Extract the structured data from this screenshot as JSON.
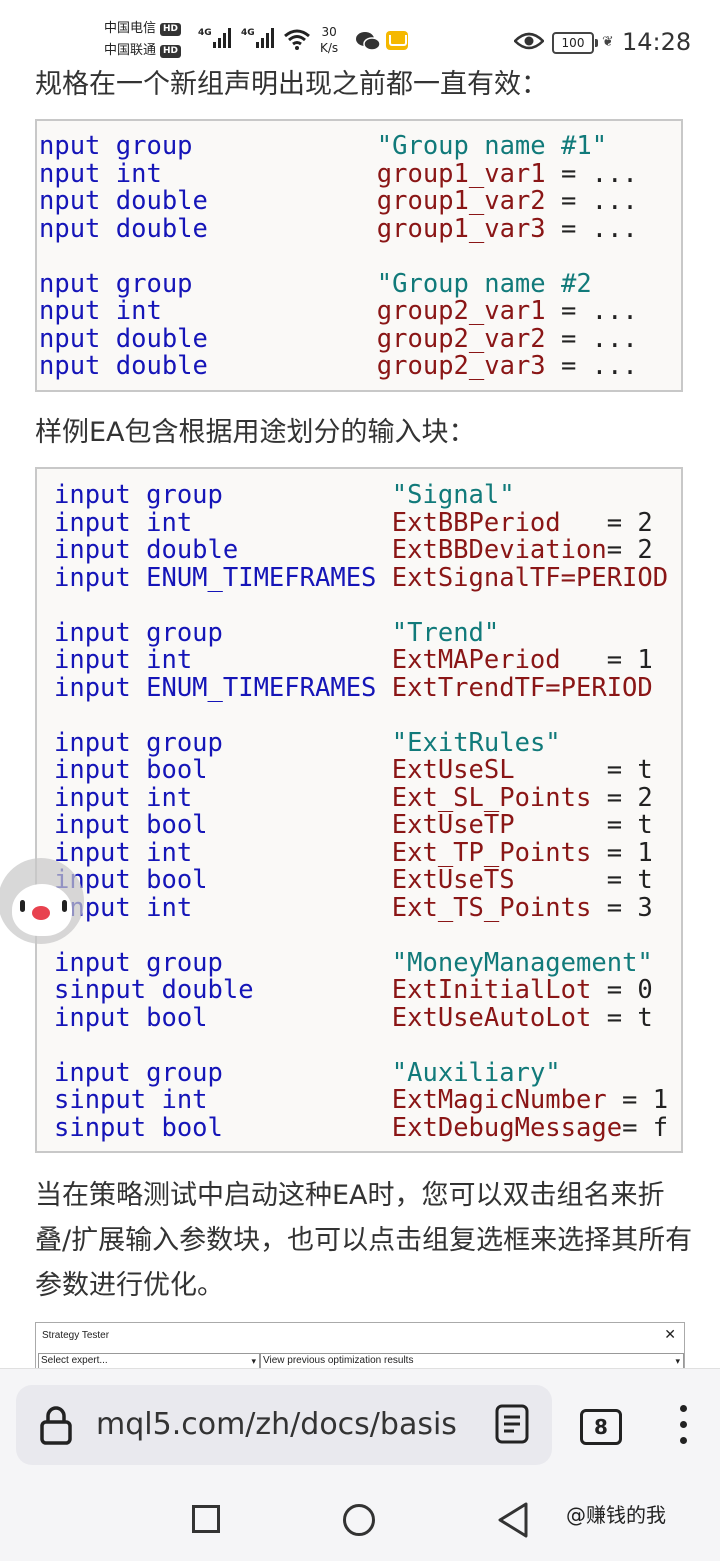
{
  "status_bar": {
    "carrier1": "中国电信",
    "carrier2": "中国联通",
    "hd": "HD",
    "net1": "4G",
    "net2": "4G",
    "speed_value": "30",
    "speed_unit": "K/s",
    "battery": "100",
    "time": "14:28"
  },
  "content": {
    "para1": "规格在一个新组声明出现之前都一直有效：",
    "para2": "样例EA包含根据用途划分的输入块：",
    "para3": "当在策略测试中启动这种EA时，您可以双击组名来折叠/扩展输入参数块，也可以点击组复选框来选择其所有参数进行优化。",
    "code1": [
      {
        "kw": "nput group",
        "pad": "            ",
        "val": "\"Group name #1\"",
        "type": "str",
        "rest": ""
      },
      {
        "kw": "nput int",
        "pad": "              ",
        "val": "group1_var1",
        "type": "var",
        "rest": " = ..."
      },
      {
        "kw": "nput double",
        "pad": "           ",
        "val": "group1_var2",
        "type": "var",
        "rest": " = ..."
      },
      {
        "kw": "nput double",
        "pad": "           ",
        "val": "group1_var3",
        "type": "var",
        "rest": " = ..."
      },
      {
        "kw": "",
        "pad": "",
        "val": "",
        "type": "var",
        "rest": ""
      },
      {
        "kw": "nput group",
        "pad": "            ",
        "val": "\"Group name #2",
        "type": "str",
        "rest": ""
      },
      {
        "kw": "nput int",
        "pad": "              ",
        "val": "group2_var1",
        "type": "var",
        "rest": " = ..."
      },
      {
        "kw": "nput double",
        "pad": "           ",
        "val": "group2_var2",
        "type": "var",
        "rest": " = ..."
      },
      {
        "kw": "nput double",
        "pad": "           ",
        "val": "group2_var3",
        "type": "var",
        "rest": " = ..."
      }
    ],
    "code2": [
      {
        "kw": "input group",
        "pad": "           ",
        "val": "\"Signal\"",
        "type": "str",
        "rest": ""
      },
      {
        "kw": "input int",
        "pad": "             ",
        "val": "ExtBBPeriod",
        "type": "var",
        "rest": "   = 2"
      },
      {
        "kw": "input double",
        "pad": "          ",
        "val": "ExtBBDeviation",
        "type": "var",
        "rest": "= 2"
      },
      {
        "kw": "input ENUM_TIMEFRAMES",
        "pad": " ",
        "val": "ExtSignalTF=PERIOD",
        "type": "var",
        "rest": ""
      },
      {
        "kw": "",
        "pad": "",
        "val": "",
        "type": "var",
        "rest": ""
      },
      {
        "kw": "input group",
        "pad": "           ",
        "val": "\"Trend\"",
        "type": "str",
        "rest": ""
      },
      {
        "kw": "input int",
        "pad": "             ",
        "val": "ExtMAPeriod",
        "type": "var",
        "rest": "   = 1"
      },
      {
        "kw": "input ENUM_TIMEFRAMES",
        "pad": " ",
        "val": "ExtTrendTF=PERIOD",
        "type": "var",
        "rest": ""
      },
      {
        "kw": "",
        "pad": "",
        "val": "",
        "type": "var",
        "rest": ""
      },
      {
        "kw": "input group",
        "pad": "           ",
        "val": "\"ExitRules\"",
        "type": "str",
        "rest": ""
      },
      {
        "kw": "input bool",
        "pad": "            ",
        "val": "ExtUseSL",
        "type": "var",
        "rest": "      = t"
      },
      {
        "kw": "input int",
        "pad": "             ",
        "val": "Ext_SL_Points",
        "type": "var",
        "rest": " = 2"
      },
      {
        "kw": "input bool",
        "pad": "            ",
        "val": "ExtUseTP",
        "type": "var",
        "rest": "      = t"
      },
      {
        "kw": "input int",
        "pad": "             ",
        "val": "Ext_TP_Points",
        "type": "var",
        "rest": " = 1"
      },
      {
        "kw": "input bool",
        "pad": "            ",
        "val": "ExtUseTS",
        "type": "var",
        "rest": "      = t"
      },
      {
        "kw": "input int",
        "pad": "             ",
        "val": "Ext_TS_Points",
        "type": "var",
        "rest": " = 3"
      },
      {
        "kw": "",
        "pad": "",
        "val": "",
        "type": "var",
        "rest": ""
      },
      {
        "kw": "input group",
        "pad": "           ",
        "val": "\"MoneyManagement\"",
        "type": "str",
        "rest": ""
      },
      {
        "kw": "sinput double",
        "pad": "         ",
        "val": "ExtInitialLot",
        "type": "var",
        "rest": " = 0"
      },
      {
        "kw": "input bool",
        "pad": "            ",
        "val": "ExtUseAutoLot",
        "type": "var",
        "rest": " = t"
      },
      {
        "kw": "",
        "pad": "",
        "val": "",
        "type": "var",
        "rest": ""
      },
      {
        "kw": "input group",
        "pad": "           ",
        "val": "\"Auxiliary\"",
        "type": "str",
        "rest": ""
      },
      {
        "kw": "sinput int",
        "pad": "            ",
        "val": "ExtMagicNumber",
        "type": "var",
        "rest": " = 1"
      },
      {
        "kw": "sinput bool",
        "pad": "           ",
        "val": "ExtDebugMessage",
        "type": "var",
        "rest": "= f"
      }
    ],
    "tester": {
      "title": "Strategy Tester",
      "close": "✕",
      "expert_select": "Select expert...",
      "results_select": "View previous optimization results"
    }
  },
  "browser": {
    "url": "mql5.com/zh/docs/basis",
    "tab_count": "8"
  },
  "watermark": "@赚钱的我",
  "colors": {
    "keyword": "#1515b8",
    "string": "#117a7a",
    "variable": "#8a1616",
    "code_bg": "#faf9f7"
  }
}
